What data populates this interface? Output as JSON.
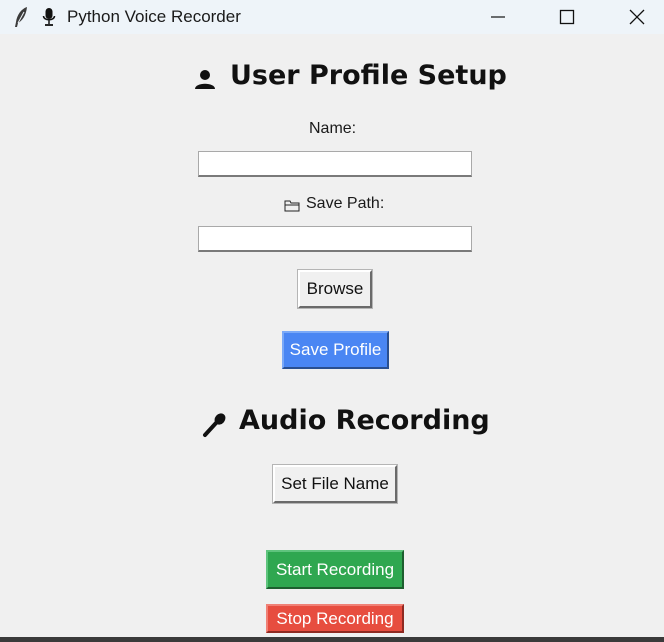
{
  "window": {
    "title": "Python Voice Recorder",
    "feather_icon": "feather-icon",
    "app_icon": "microphone-icon",
    "controls": [
      "minimize-icon",
      "maximize-icon",
      "close-icon"
    ]
  },
  "profile": {
    "heading": "User Profile Setup",
    "heading_icon": "user-icon",
    "name_label": "Name:",
    "name_value": "",
    "save_path_label": "Save Path:",
    "save_path_icon": "folder-icon",
    "save_path_value": "",
    "browse_label": "Browse",
    "save_profile_label": "Save Profile"
  },
  "recording": {
    "heading": "Audio Recording",
    "heading_icon": "microphone-icon",
    "set_file_name_label": "Set File Name",
    "start_label": "Start Recording",
    "stop_label": "Stop Recording"
  },
  "colors": {
    "save_profile": "#4a86f3",
    "start_recording": "#2fa750",
    "stop_recording": "#e74d3f",
    "titlebar": "#eef4f9",
    "window_bg": "#f0f0f0"
  }
}
